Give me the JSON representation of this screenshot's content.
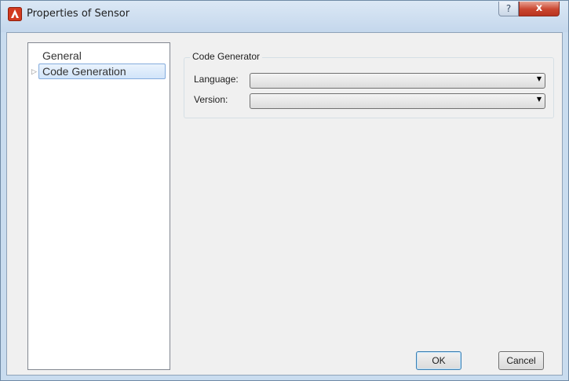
{
  "window": {
    "title": "Properties of Sensor",
    "help_label": "?",
    "close_label": "x"
  },
  "tree": {
    "items": [
      {
        "label": "General",
        "selected": false,
        "expandable": false
      },
      {
        "label": "Code Generation",
        "selected": true,
        "expandable": true
      }
    ]
  },
  "code_generator": {
    "legend": "Code Generator",
    "language_label": "Language:",
    "language_value": "",
    "version_label": "Version:",
    "version_value": ""
  },
  "buttons": {
    "ok_label": "OK",
    "cancel_label": "Cancel"
  },
  "colors": {
    "title_bar": "#c9dcef",
    "close_button": "#c9452f",
    "selection": "#d1e4f9"
  }
}
